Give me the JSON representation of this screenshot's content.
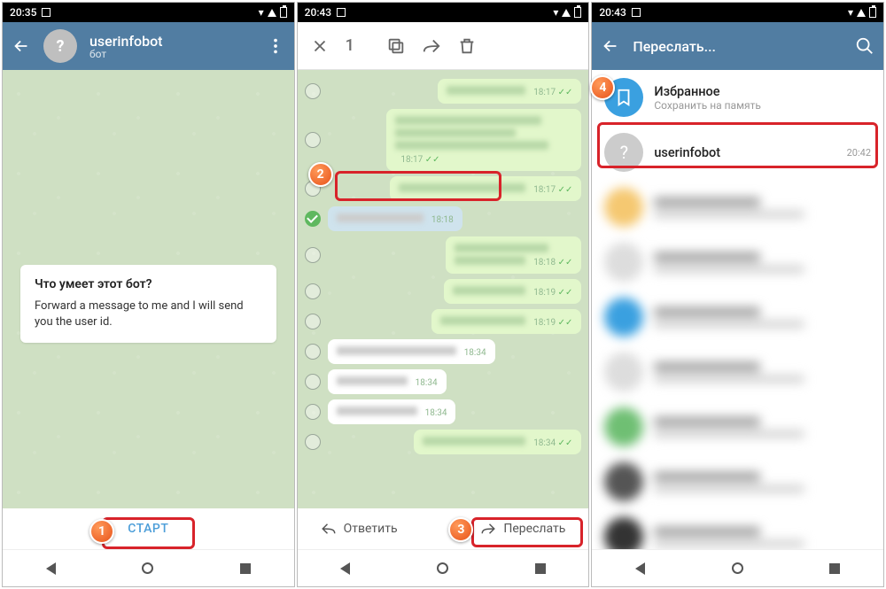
{
  "screen1": {
    "status_time": "20:35",
    "header": {
      "title": "userinfobot",
      "subtitle": "бот"
    },
    "card": {
      "heading": "Что умеет этот бот?",
      "body": "Forward a message to me and I will send you the user id."
    },
    "start_label": "СТАРТ"
  },
  "screen2": {
    "status_time": "20:43",
    "selection_count": "1",
    "messages": [
      {
        "side": "out",
        "time": "18:17",
        "ticks": true
      },
      {
        "side": "out",
        "time": "18:17",
        "ticks": true,
        "lines": 3
      },
      {
        "side": "out",
        "time": "18:17",
        "ticks": true
      },
      {
        "side": "in",
        "time": "18:18",
        "selected": true
      },
      {
        "side": "out",
        "time": "18:18",
        "ticks": true,
        "lines": 2
      },
      {
        "side": "out",
        "time": "18:19",
        "ticks": true
      },
      {
        "side": "out",
        "time": "18:19",
        "ticks": true
      },
      {
        "side": "in",
        "time": "18:34"
      },
      {
        "side": "in",
        "time": "18:34"
      },
      {
        "side": "in",
        "time": "18:34"
      },
      {
        "side": "out",
        "time": "18:34",
        "ticks": true
      }
    ],
    "reply_label": "Ответить",
    "forward_label": "Переслать"
  },
  "screen3": {
    "status_time": "20:43",
    "header_title": "Переслать...",
    "items": [
      {
        "name": "Избранное",
        "preview": "Сохранить на память",
        "time": "",
        "fav": true
      },
      {
        "name": "userinfobot",
        "preview": "",
        "time": "20:42",
        "highlight": true
      }
    ]
  }
}
